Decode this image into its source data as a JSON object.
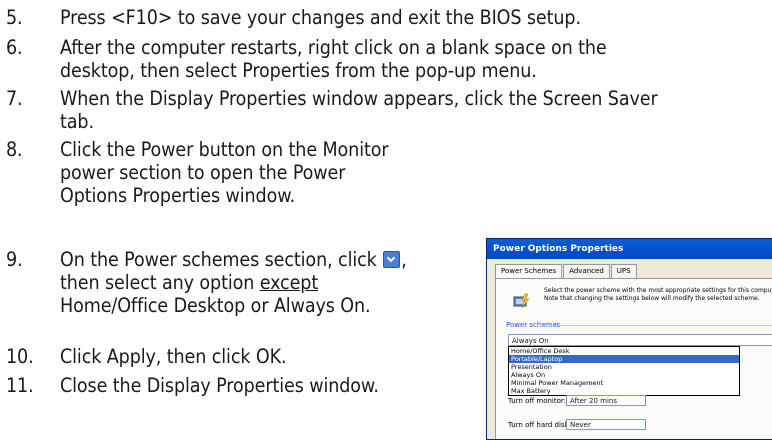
{
  "steps": [
    {
      "num": "5.",
      "lines": [
        "Press <F10> to save your changes and exit the BIOS setup."
      ]
    },
    {
      "num": "6.",
      "lines": [
        "After the computer restarts, right click on a blank space on the",
        "desktop, then select Properties from the pop-up menu."
      ]
    },
    {
      "num": "7.",
      "lines": [
        "When the Display Properties window appears, click the Screen Saver",
        "tab."
      ]
    },
    {
      "num": "8.",
      "lines": [
        "Click the Power button on the Monitor",
        "power section to open the Power",
        "Options Properties window."
      ]
    },
    {
      "num": "9.",
      "line1_before": "On the Power schemes section, click",
      "line1_after": ",",
      "line2_before": "then select any option",
      "line2_underlined": "except",
      "line3": "Home/Office Desktop or Always On."
    },
    {
      "num": "10.",
      "lines": [
        "Click Apply, then click OK."
      ]
    },
    {
      "num": "11.",
      "lines": [
        "Close the Display Properties window."
      ]
    }
  ],
  "icons": {
    "dropdown_button": "chevron-down-icon"
  },
  "dialog": {
    "title": "Power Options Properties",
    "tabs": [
      "Power Schemes",
      "Advanced",
      "UPS"
    ],
    "description": "Select the power scheme with the most appropriate settings for this computer. Note that changing the settings below will modify the selected scheme.",
    "group_label": "Power schemes",
    "combo_value": "Always On",
    "dropdown_options": [
      "Home/Office Desk",
      "Portable/Laptop",
      "Presentation",
      "Always On",
      "Minimal Power Management",
      "Max Battery"
    ],
    "selected_option": "Portable/Laptop",
    "rows": [
      {
        "label": "Turn off monitor:",
        "value": "After 20 mins"
      },
      {
        "label": "Turn off hard disks:",
        "value": "Never"
      }
    ]
  },
  "colors": {
    "title_bar": "#0a5fd8",
    "highlight": "#316ac5",
    "dialog_bg": "#ece9d8"
  }
}
